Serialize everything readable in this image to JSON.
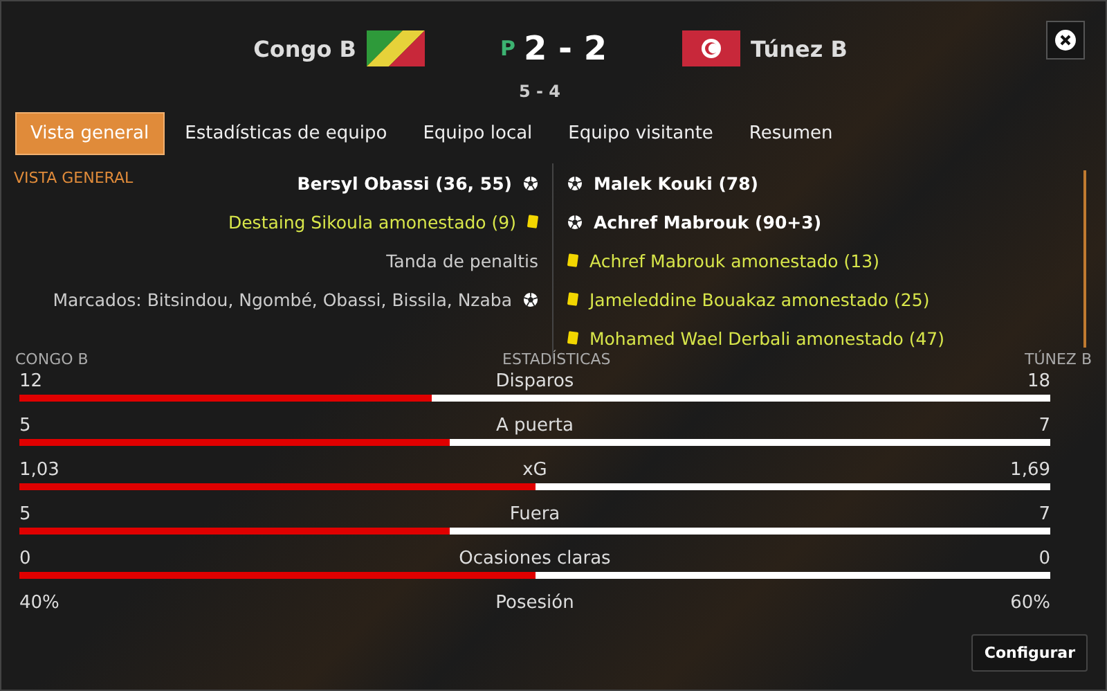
{
  "header": {
    "home_team": "Congo B",
    "away_team": "Túnez B",
    "result_mark": "P",
    "score": "2 - 2",
    "penalty_score": "5 - 4"
  },
  "tabs": [
    {
      "label": "Vista general",
      "selected": true
    },
    {
      "label": "Estadísticas de equipo",
      "selected": false
    },
    {
      "label": "Equipo local",
      "selected": false
    },
    {
      "label": "Equipo visitante",
      "selected": false
    },
    {
      "label": "Resumen",
      "selected": false
    }
  ],
  "section_title": "VISTA GENERAL",
  "home_events": [
    {
      "kind": "goal",
      "text": "Bersyl Obassi (36, 55)"
    },
    {
      "kind": "card",
      "text": "Destaing Sikoula amonestado (9)"
    },
    {
      "kind": "text",
      "text": "Tanda de penaltis"
    },
    {
      "kind": "shootout",
      "text": "Marcados: Bitsindou, Ngombé, Obassi, Bissila, Nzaba"
    }
  ],
  "away_events": [
    {
      "kind": "goal",
      "text": "Malek Kouki (78)"
    },
    {
      "kind": "goal",
      "text": "Achref Mabrouk (90+3)"
    },
    {
      "kind": "card",
      "text": "Achref Mabrouk amonestado (13)"
    },
    {
      "kind": "card",
      "text": "Jameleddine Bouakaz amonestado (25)"
    },
    {
      "kind": "card",
      "text": "Mohamed Wael Derbali amonestado (47)"
    }
  ],
  "stats_header": {
    "home": "CONGO B",
    "title": "ESTADÍSTICAS",
    "away": "TÚNEZ B"
  },
  "stats": [
    {
      "label": "Disparos",
      "home": "12",
      "away": "18",
      "level": 0.4
    },
    {
      "label": "A puerta",
      "home": "5",
      "away": "7",
      "level": 0.417
    },
    {
      "label": "xG",
      "home": "1,03",
      "away": "1,69",
      "level": 0.5
    },
    {
      "label": "Fuera",
      "home": "5",
      "away": "7",
      "level": 0.417
    },
    {
      "label": "Ocasiones claras",
      "home": "0",
      "away": "0",
      "level": 0.5
    },
    {
      "label": "Posesión",
      "home": "40%",
      "away": "60%"
    }
  ],
  "configure_button": "Configurar"
}
